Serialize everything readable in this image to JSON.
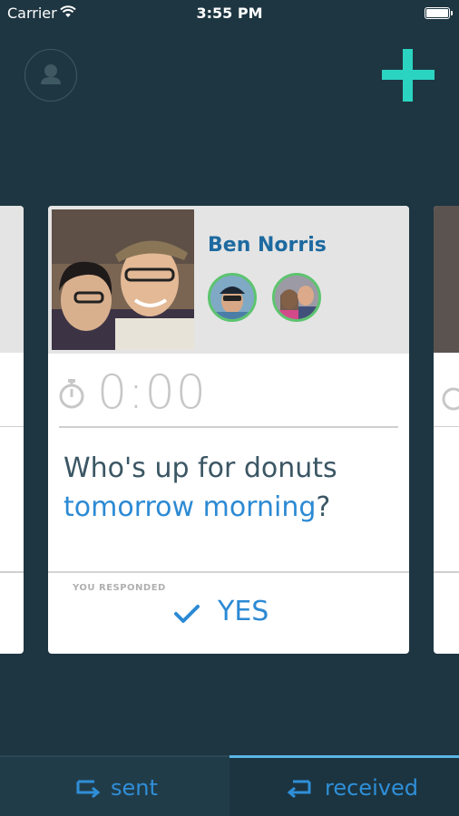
{
  "status_bar": {
    "carrier": "Carrier",
    "time": "3:55 PM"
  },
  "header": {
    "profile_icon": "person-icon",
    "add_icon": "plus-icon",
    "accent_color": "#2bd4c0"
  },
  "card": {
    "sender_name": "Ben Norris",
    "timer": "0:00",
    "question_text": "Who's up for donuts",
    "question_link": "tomorrow morning",
    "question_end": "?",
    "responded_label": "YOU RESPONDED",
    "response": "YES"
  },
  "tabs": [
    {
      "label": "sent",
      "icon": "sent-icon",
      "active": false
    },
    {
      "label": "received",
      "icon": "received-icon",
      "active": true
    }
  ],
  "colors": {
    "background": "#1e3641",
    "link": "#2c8ad4",
    "name": "#1d6aa0",
    "avatar_ring": "#5cc46f"
  }
}
